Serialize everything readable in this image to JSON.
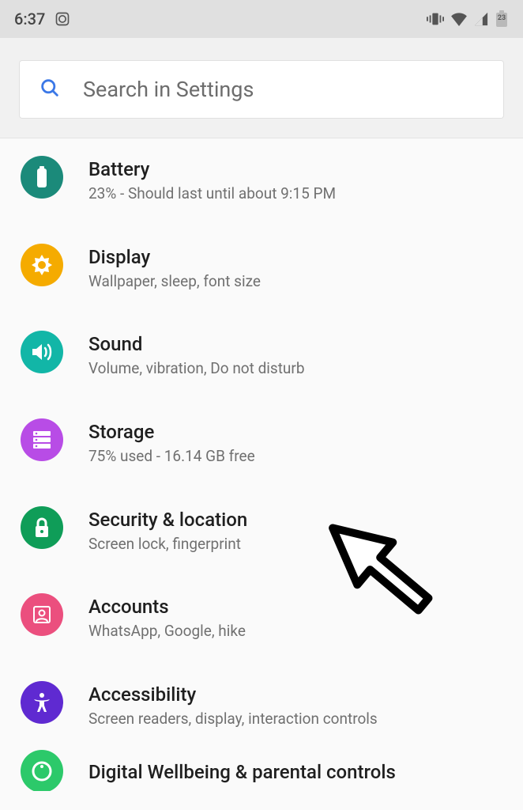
{
  "status": {
    "time": "6:37",
    "battery_badge": "23"
  },
  "search": {
    "placeholder": "Search in Settings"
  },
  "items": [
    {
      "key": "battery",
      "title": "Battery",
      "sub": "23% - Should last until about 9:15 PM",
      "icon": "battery-icon",
      "color": "c-battery"
    },
    {
      "key": "display",
      "title": "Display",
      "sub": "Wallpaper, sleep, font size",
      "icon": "brightness-icon",
      "color": "c-display"
    },
    {
      "key": "sound",
      "title": "Sound",
      "sub": "Volume, vibration, Do not disturb",
      "icon": "sound-icon",
      "color": "c-sound"
    },
    {
      "key": "storage",
      "title": "Storage",
      "sub": "75% used - 16.14 GB free",
      "icon": "storage-icon",
      "color": "c-storage"
    },
    {
      "key": "security",
      "title": "Security & location",
      "sub": "Screen lock, fingerprint",
      "icon": "lock-icon",
      "color": "c-security"
    },
    {
      "key": "accounts",
      "title": "Accounts",
      "sub": "WhatsApp, Google, hike",
      "icon": "account-icon",
      "color": "c-accounts"
    },
    {
      "key": "accessibility",
      "title": "Accessibility",
      "sub": "Screen readers, display, interaction controls",
      "icon": "accessibility-icon",
      "color": "c-access"
    },
    {
      "key": "wellbeing",
      "title": "Digital Wellbeing & parental controls",
      "sub": "",
      "icon": "wellbeing-icon",
      "color": "c-wellbeing"
    }
  ],
  "annotation": {
    "arrow_points_to": "accounts"
  }
}
